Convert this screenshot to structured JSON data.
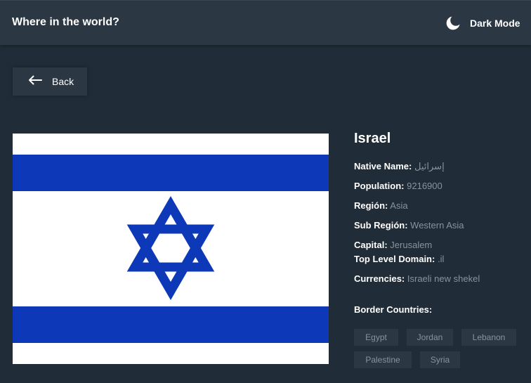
{
  "header": {
    "title": "Where in the world?",
    "theme_toggle_label": "Dark Mode",
    "theme_icon": "moon-icon"
  },
  "back_button": {
    "label": "Back",
    "icon": "arrow-left-icon"
  },
  "flag": {
    "description_icon": "israel-flag-image",
    "colors": {
      "stripe": "#0d38b8",
      "background": "#ffffff"
    }
  },
  "country": {
    "name": "Israel",
    "fields": {
      "native_name": {
        "label": "Native Name:",
        "value": "إسرائيل"
      },
      "population": {
        "label": "Population:",
        "value": "9216900"
      },
      "region": {
        "label": "Región:",
        "value": "Asia"
      },
      "sub_region": {
        "label": "Sub Región:",
        "value": "Western Asia"
      },
      "capital": {
        "label": "Capital:",
        "value": "Jerusalem"
      },
      "top_level_domain": {
        "label": "Top Level Domain:",
        "value": ".il"
      },
      "currencies": {
        "label": "Currencies:",
        "value": "Israeli new shekel"
      }
    },
    "border_countries_label": "Border Countries:",
    "border_countries": [
      "Egypt",
      "Jordan",
      "Lebanon",
      "Palestine",
      "Syria"
    ]
  },
  "colors": {
    "background": "#202c37",
    "element": "#2b3743",
    "text": "#ffffff",
    "muted_text": "#8a939c"
  }
}
